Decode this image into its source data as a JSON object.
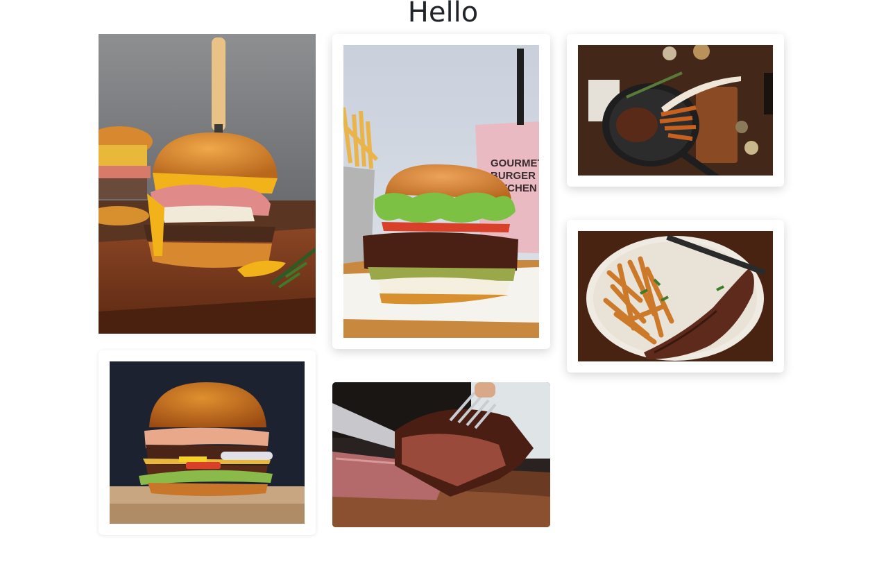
{
  "page": {
    "title": "Hello"
  },
  "gallery": {
    "images": [
      {
        "subject": "burger-with-melted-cheese-and-knife-on-board"
      },
      {
        "subject": "gourmet-burger-with-fries-and-milkshake"
      },
      {
        "subject": "steak-in-cast-iron-skillet-with-fries"
      },
      {
        "subject": "steak-frites-on-plate"
      },
      {
        "subject": "double-cheeseburger-dark-background"
      },
      {
        "subject": "sliced-brisket-with-fork-and-knife"
      }
    ],
    "milkshake_cup_text": [
      "GOURMET",
      "BURGER",
      "KITCHEN"
    ]
  },
  "colors": {
    "title": "#212529",
    "card_bg": "#ffffff",
    "bun": "#d8882e",
    "cheese": "#f2b21a",
    "wood": "#7a3d1e",
    "meat": "#5a2a18"
  }
}
